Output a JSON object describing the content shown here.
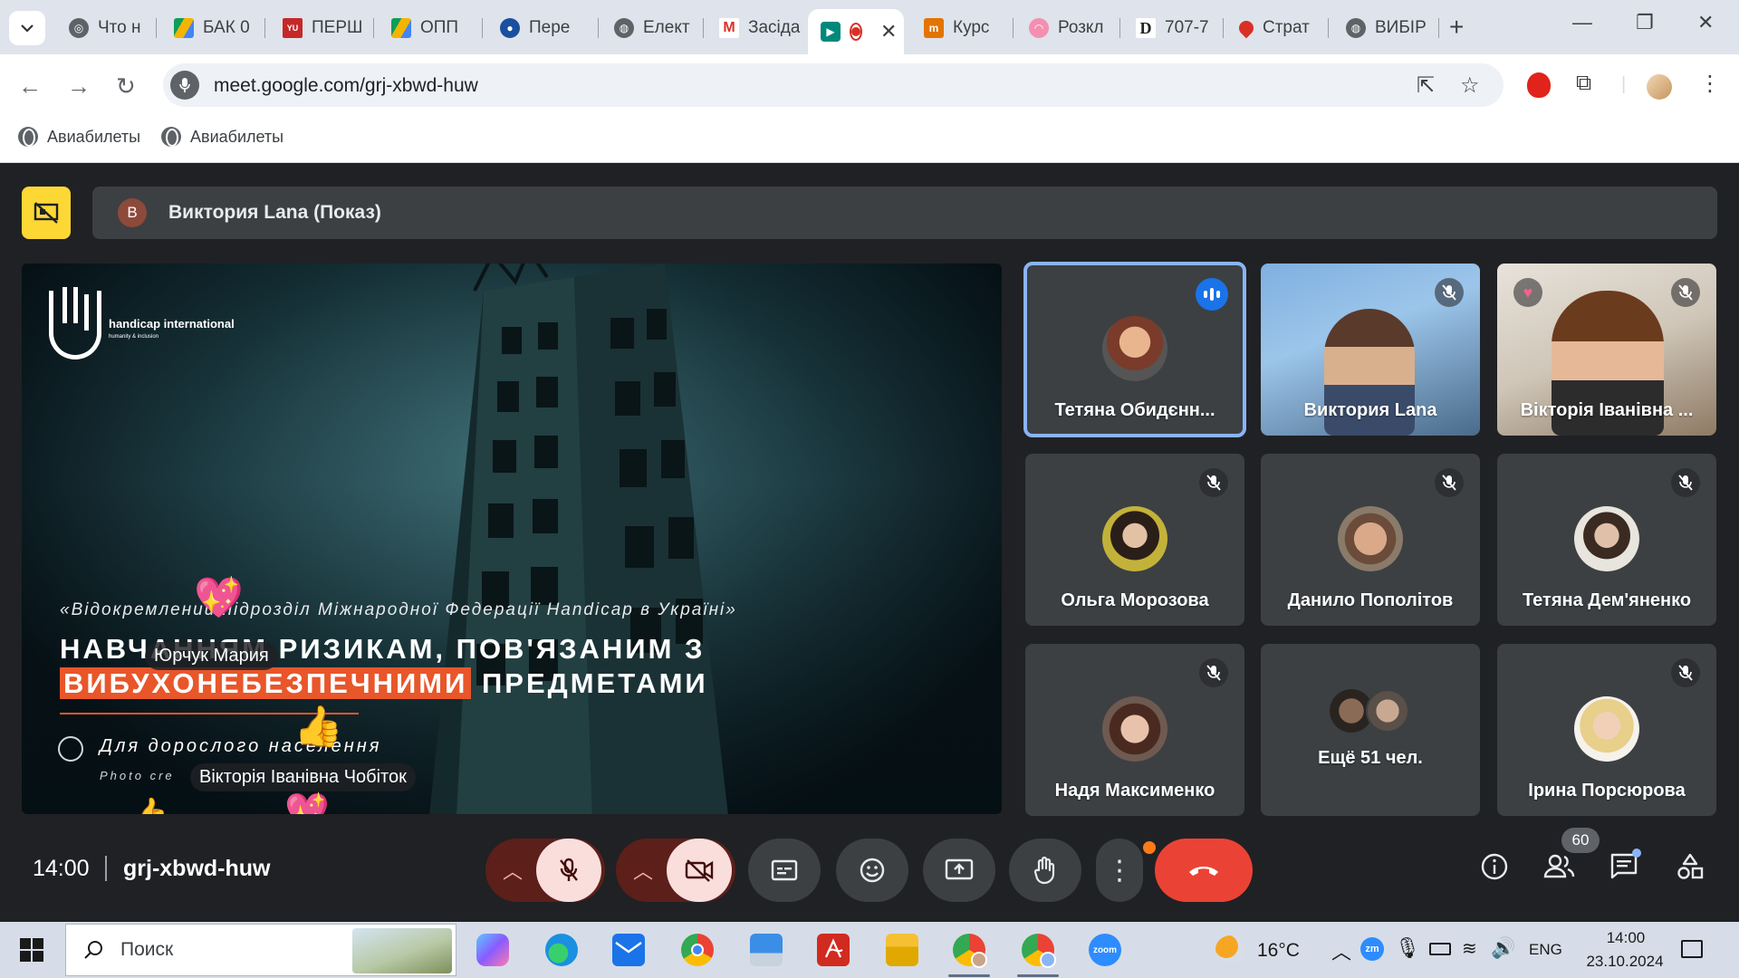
{
  "browser": {
    "tabs": [
      {
        "title": "Что н",
        "icon": "chrome-icon",
        "color": "#5f6368"
      },
      {
        "title": "БАК 0",
        "icon": "google-drive-icon",
        "color": "#1e8e3e"
      },
      {
        "title": "ПЕРШ",
        "icon": "yufa-icon",
        "color": "#c62828"
      },
      {
        "title": "ОПП",
        "icon": "google-drive-icon",
        "color": "#1e8e3e"
      },
      {
        "title": "Пере",
        "icon": "site-icon",
        "color": "#1a4fa0"
      },
      {
        "title": "Елект",
        "icon": "globe-icon",
        "color": "#5f6368"
      },
      {
        "title": "Засіда",
        "icon": "gmail-icon",
        "color": "#d93025"
      },
      {
        "title": "",
        "icon": "google-meet-icon",
        "color": "#00897b",
        "active": true
      },
      {
        "title": "Курс",
        "icon": "site-icon",
        "color": "#e37400"
      },
      {
        "title": "Розкл",
        "icon": "site-icon",
        "color": "#c2185b"
      },
      {
        "title": "707-7",
        "icon": "d-icon",
        "color": "#202124"
      },
      {
        "title": "Страт",
        "icon": "map-pin-icon",
        "color": "#d93025"
      },
      {
        "title": "ВИБІР",
        "icon": "globe-icon",
        "color": "#5f6368"
      }
    ],
    "url": "meet.google.com/grj-xbwd-huw",
    "bookmarks": [
      {
        "label": "Авиабилеты",
        "icon": "globe-icon"
      },
      {
        "label": "Авиабилеты",
        "icon": "globe-icon"
      }
    ]
  },
  "meet": {
    "presenter": {
      "initial": "В",
      "title": "Виктория Lana (Показ)"
    },
    "slide": {
      "logo_text": "handicap international",
      "logo_sub": "humanity & inclusion",
      "subtitle": "«Відокремлений підрозділ Міжнародної Федерації Handicap в Україні»",
      "line1": "НАВЧАННЯМ РИЗИКАМ, ПОВ'ЯЗАНИМ З",
      "line2_highlight": "ВИБУХОНЕБЕЗПЕЧНИМИ",
      "line2_rest": " ПРЕДМЕТАМИ",
      "audience": "Для дорослого населення",
      "photo_credit": "Photo cre"
    },
    "reactions": [
      {
        "name": "Юрчук Мария",
        "emoji": "💖"
      },
      {
        "name": "Вікторія Іванівна Чобіток",
        "emoji": "👍"
      }
    ],
    "tiles": [
      {
        "name": "Тетяна Обидєнн...",
        "speaking": true,
        "muted": false,
        "avatar": "#b07a5a"
      },
      {
        "name": "Виктория Lana",
        "speaking": false,
        "muted": true,
        "video": true
      },
      {
        "name": "Вікторія Іванівна ...",
        "speaking": false,
        "muted": true,
        "video": true,
        "heart": true
      },
      {
        "name": "Ольга Морозова",
        "speaking": false,
        "muted": true,
        "avatar": "#6d7a2a"
      },
      {
        "name": "Данило Пополітов",
        "speaking": false,
        "muted": true,
        "avatar": "#8a6c5a"
      },
      {
        "name": "Тетяна Дем'яненко",
        "speaking": false,
        "muted": true,
        "avatar": "#a08f7e"
      },
      {
        "name": "Надя Максименко",
        "speaking": false,
        "muted": true,
        "avatar": "#5a3a30"
      },
      {
        "name": "Ещё 51 чел.",
        "speaking": false,
        "muted": false,
        "more": true
      },
      {
        "name": "Ірина Порсюрова",
        "speaking": false,
        "muted": true,
        "avatar": "#e6c9a8"
      }
    ],
    "time": "14:00",
    "meeting_code": "grj-xbwd-huw",
    "participant_count": "60"
  },
  "taskbar": {
    "search_placeholder": "Поиск",
    "weather_temp": "16°C",
    "language": "ENG",
    "time": "14:00",
    "date": "23.10.2024",
    "zoom_label": "zoom"
  },
  "colors": {
    "accent_blue": "#8ab4f8",
    "end_call": "#ea4335",
    "slide_highlight": "#e8562a",
    "presenter_badge": "#fdd835"
  }
}
